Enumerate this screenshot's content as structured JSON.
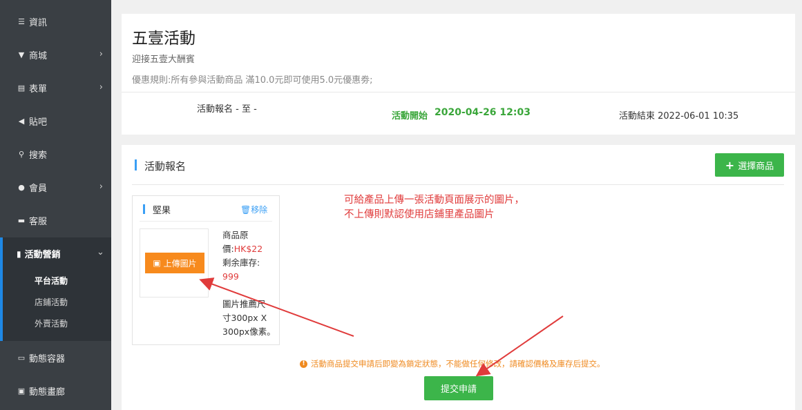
{
  "sidebar": {
    "items": [
      {
        "label": "資訊",
        "icon": "list-icon"
      },
      {
        "label": "商城",
        "icon": "cart-icon"
      },
      {
        "label": "表單",
        "icon": "form-icon"
      },
      {
        "label": "貼吧",
        "icon": "megaphone-icon"
      },
      {
        "label": "搜索",
        "icon": "search-icon"
      },
      {
        "label": "會員",
        "icon": "bell-icon"
      },
      {
        "label": "客服",
        "icon": "chat-icon"
      },
      {
        "label": "活動營銷",
        "icon": "bookmark-icon"
      },
      {
        "label": "動態容器",
        "icon": "container-icon"
      },
      {
        "label": "動態畫廊",
        "icon": "image-icon"
      }
    ],
    "subitems": [
      "平台活動",
      "店鋪活動",
      "外賣活動"
    ]
  },
  "activity": {
    "title": "五壹活動",
    "subtitle": "迎接五壹大酬賓",
    "rule": "優惠規則:所有參與活動商品 滿10.0元即可使用5.0元優惠劵;",
    "signup_time": "活動報名 - 至 -",
    "start_label": "活動開始",
    "start_value": "2020-04-26 12:03",
    "end_text": "活動結束 2022-06-01 10:35"
  },
  "signup": {
    "section_title": "活動報名",
    "select_button": "選擇商品",
    "product": {
      "name": "堅果",
      "remove": "移除",
      "upload": "上傳圖片",
      "price_label_1": "商品原",
      "price_label_2": "價:",
      "price_value": "HK$22",
      "stock_label": "剩余庫存:",
      "stock_value": "999",
      "image_hint_1": "圖片推薦尺",
      "image_hint_2": "寸300px X",
      "image_hint_3": "300px像素。"
    },
    "annotation_line1": "可給產品上傳一張活動頁面展示的圖片，",
    "annotation_line2": "不上傳則默認使用店鋪里產品圖片",
    "warning": "活動商品提交申請后即變為鎖定狀態，不能做任何修改，請確認價格及庫存后提交。",
    "submit_button": "提交申請"
  },
  "colors": {
    "sidebar_bg": "#3a3f44",
    "accent_blue": "#3a9ff5",
    "green": "#3cb54a",
    "orange": "#f78a1d",
    "annotation_red": "#e03b3b"
  }
}
